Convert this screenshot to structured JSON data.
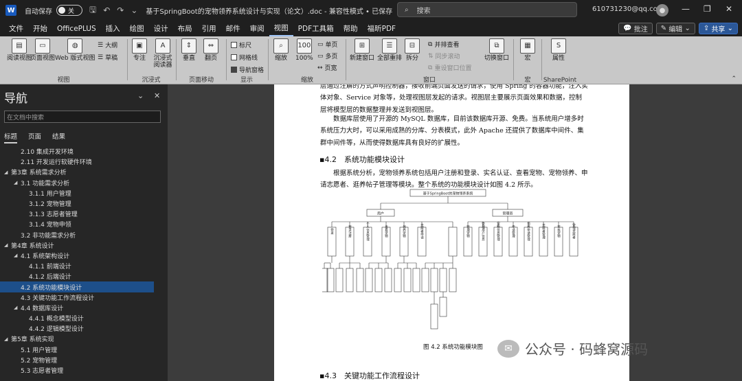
{
  "titlebar": {
    "app_icon": "W",
    "autosave": "自动保存",
    "toggle": "关",
    "doc_title": "基于SpringBoot的宠物领养系统设计与实现（论文）.doc - 兼容性模式 • 已保存",
    "search": "搜索",
    "account": "610731230@qq.com"
  },
  "menu": [
    "文件",
    "开始",
    "OfficePLUS",
    "插入",
    "绘图",
    "设计",
    "布局",
    "引用",
    "邮件",
    "审阅",
    "视图",
    "PDF工具箱",
    "帮助",
    "福昕PDF"
  ],
  "menu_right": {
    "comment": "批注",
    "edit": "编辑",
    "share": "共享"
  },
  "ribbon": {
    "views": [
      "阅读视图",
      "页面视图",
      "Web 版式视图"
    ],
    "views_small": [
      "大纲",
      "草稿"
    ],
    "views_label": "视图",
    "immersive": [
      "专注",
      "沉浸式阅读器"
    ],
    "immersive_label": "沉浸式",
    "movement": [
      "垂直",
      "翻页"
    ],
    "movement_label": "页面移动",
    "show": [
      "标尺",
      "网格线",
      "导航窗格"
    ],
    "show_label": "显示",
    "zoom": [
      "缩放",
      "100%"
    ],
    "zoom_small": [
      "单页",
      "多页",
      "页宽"
    ],
    "zoom_label": "缩放",
    "window": [
      "新建窗口",
      "全部重排",
      "拆分"
    ],
    "window_small": [
      "并排查看",
      "同步滚动",
      "重设窗口位置"
    ],
    "switch": "切换窗口",
    "window_label": "窗口",
    "macro": "宏",
    "macro_label": "宏",
    "prop": "属性",
    "sp_label": "SharePoint"
  },
  "nav": {
    "title": "导航",
    "search_placeholder": "在文档中搜索",
    "tabs": [
      "标题",
      "页面",
      "结果"
    ],
    "items": [
      {
        "t": "2.10 集成开发环境",
        "lvl": 2,
        "ar": ""
      },
      {
        "t": "2.11 开发运行软硬件环境",
        "lvl": 2,
        "ar": ""
      },
      {
        "t": "第3章 系统需求分析",
        "lvl": 1,
        "ar": "◢"
      },
      {
        "t": "3.1 功能需求分析",
        "lvl": 2,
        "ar": "◢"
      },
      {
        "t": "3.1.1 用户管理",
        "lvl": 3,
        "ar": ""
      },
      {
        "t": "3.1.2 宠物管理",
        "lvl": 3,
        "ar": ""
      },
      {
        "t": "3.1.3 志愿者管理",
        "lvl": 3,
        "ar": ""
      },
      {
        "t": "3.1.4 宠物申领",
        "lvl": 3,
        "ar": ""
      },
      {
        "t": "3.2 非功能需求分析",
        "lvl": 2,
        "ar": ""
      },
      {
        "t": "第4章 系统设计",
        "lvl": 1,
        "ar": "◢"
      },
      {
        "t": "4.1 系统架构设计",
        "lvl": 2,
        "ar": "◢"
      },
      {
        "t": "4.1.1 前端设计",
        "lvl": 3,
        "ar": ""
      },
      {
        "t": "4.1.2 后端设计",
        "lvl": 3,
        "ar": ""
      },
      {
        "t": "4.2 系统功能模块设计",
        "lvl": 2,
        "ar": "",
        "sel": true
      },
      {
        "t": "4.3 关键功能工作流程设计",
        "lvl": 2,
        "ar": ""
      },
      {
        "t": "4.4 数据库设计",
        "lvl": 2,
        "ar": "◢"
      },
      {
        "t": "4.4.1 概念模型设计",
        "lvl": 3,
        "ar": ""
      },
      {
        "t": "4.4.2 逻辑模型设计",
        "lvl": 3,
        "ar": ""
      },
      {
        "t": "第5章 系统实现",
        "lvl": 1,
        "ar": "◢"
      },
      {
        "t": "5.1 用户管理",
        "lvl": 2,
        "ar": ""
      },
      {
        "t": "5.2 宠物管理",
        "lvl": 2,
        "ar": ""
      },
      {
        "t": "5.3 志愿者管理",
        "lvl": 2,
        "ar": ""
      }
    ]
  },
  "doc": {
    "p0": "层通过注解的方式声明控制器，接收前端页面发送的请求，使用 Spring 的容器功能，注入实体对象、Service 对象等，处理视图层发起的请求。视图层主要展示页面效果和数据，控制层将模型层的数据整理并发送到视图层。",
    "p1": "数据库层使用了开源的 MySQL 数据库，目前该数据库开源、免费。当系统用户增多时系统压力大时，可以采用成熟的分库、分表模式，此外 Apache 还提供了数据库中间件、集群中间件等，从而使得数据库具有良好的扩展性。",
    "h42": "4.2　系统功能模块设计",
    "p2": "根据系统分析，宠物领养系统包括用户注册和登录、实名认证、查看宠物、宠物领养、申请志愿者、逛养帖子管理等模块。整个系统的功能模块设计如图 4.2 所示。",
    "fig": {
      "root": "基于SpringBoot的宠物领养系统",
      "user": "用户",
      "admin": "管理员",
      "user_children": [
        "登录",
        "登录注册",
        "个人信息管理",
        "查看宠物",
        "领养宠物",
        "志愿者申请"
      ],
      "admin_children": [
        "管理宠物",
        "管理用户信息",
        "宠物信息管理",
        "申请管理",
        "领养申请管理",
        "志愿者管理",
        "审核宠物",
        "管理志愿者"
      ]
    },
    "caption": "图 4.2  系统功能模块图",
    "h43": "4.3　关键功能工作流程设计"
  },
  "watermark": "公众号 · 码蜂窝源码"
}
